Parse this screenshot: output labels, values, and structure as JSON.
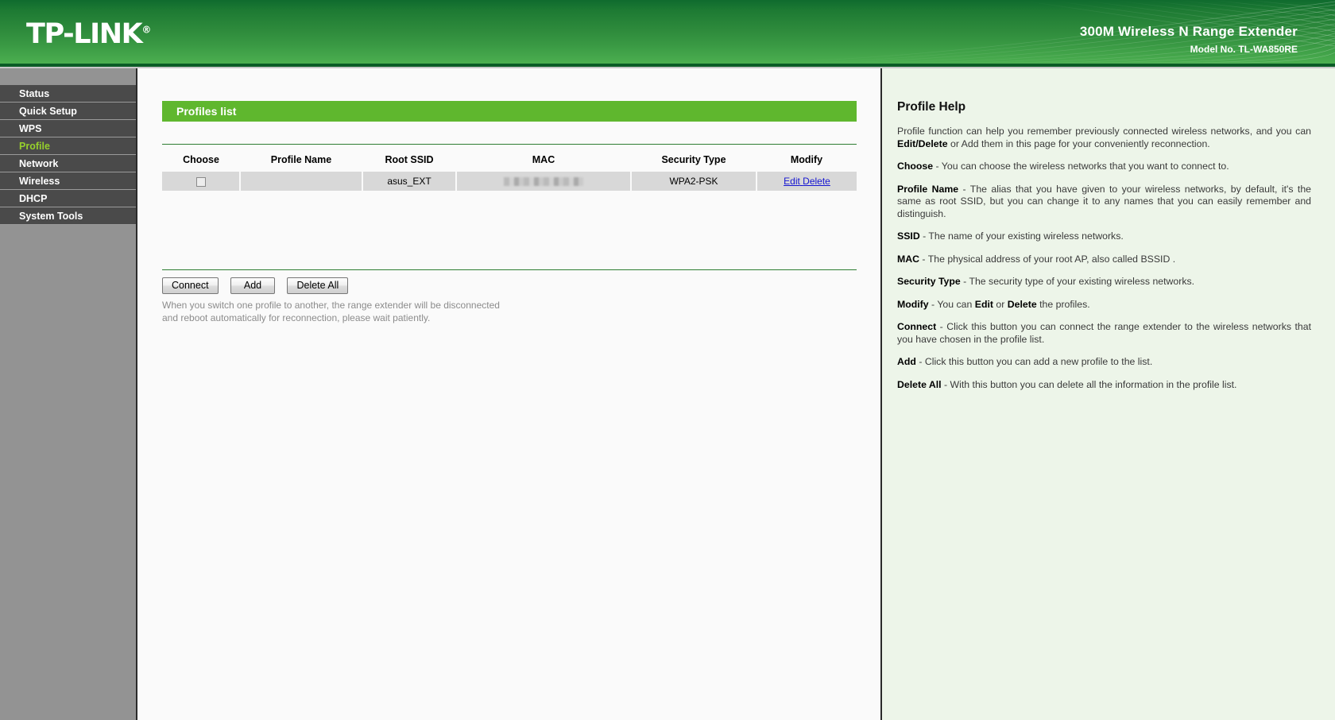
{
  "header": {
    "logo": "TP-LINK",
    "logo_mark": "®",
    "product_title": "300M Wireless N Range Extender",
    "model": "Model No. TL-WA850RE"
  },
  "sidebar": {
    "items": [
      {
        "label": "Status",
        "active": false
      },
      {
        "label": "Quick Setup",
        "active": false
      },
      {
        "label": "WPS",
        "active": false
      },
      {
        "label": "Profile",
        "active": true
      },
      {
        "label": "Network",
        "active": false
      },
      {
        "label": "Wireless",
        "active": false
      },
      {
        "label": "DHCP",
        "active": false
      },
      {
        "label": "System Tools",
        "active": false
      }
    ]
  },
  "main": {
    "panel_title": "Profiles list",
    "table": {
      "headers": [
        "Choose",
        "Profile Name",
        "Root SSID",
        "MAC",
        "Security Type",
        "Modify"
      ],
      "rows": [
        {
          "choose_checked": false,
          "profile_name": "",
          "root_ssid": "asus_EXT",
          "mac": "",
          "security_type": "WPA2-PSK",
          "edit_label": "Edit",
          "delete_label": "Delete"
        }
      ]
    },
    "buttons": {
      "connect": "Connect",
      "add": "Add",
      "delete_all": "Delete All"
    },
    "note_line1": "When you switch one profile to another, the range extender will be disconnected",
    "note_line2": "and reboot automatically for reconnection, please wait patiently."
  },
  "help": {
    "title": "Profile Help",
    "p1_a": "Profile function can help you remember previously connected wireless networks, and you can ",
    "p1_b": "Edit/Delete",
    "p1_c": " or Add them in this page for your conveniently reconnection.",
    "p2_b": "Choose",
    "p2_c": " - You can choose the wireless networks that you want to connect to.",
    "p3_b": "Profile Name",
    "p3_c": " - The alias that you have given to your wireless networks, by default, it's the same as root SSID, but you can change it to any names that you can easily remember and distinguish.",
    "p4_b": "SSID",
    "p4_c": " - The name of your existing wireless networks.",
    "p5_b": "MAC",
    "p5_c": " - The physical address of your root AP, also called BSSID .",
    "p6_b": "Security Type",
    "p6_c": " - The security type of your existing wireless networks.",
    "p7_b": "Modify",
    "p7_c": " - You can ",
    "p7_d": "Edit",
    "p7_e": " or ",
    "p7_f": "Delete",
    "p7_g": " the profiles.",
    "p8_b": "Connect",
    "p8_c": " - Click this button you can connect the range extender to the wireless networks that you have chosen in the profile list.",
    "p9_b": "Add",
    "p9_c": " - Click this button you can add a new profile to the list.",
    "p10_b": "Delete All",
    "p10_c": " - With this button you can delete all the information in the profile list."
  },
  "colors": {
    "brand_green": "#2e8b3c",
    "panel_green": "#5fb72e",
    "active_menu": "#96d02c",
    "link_blue": "#1414d2",
    "help_bg": "#edf5e9"
  }
}
